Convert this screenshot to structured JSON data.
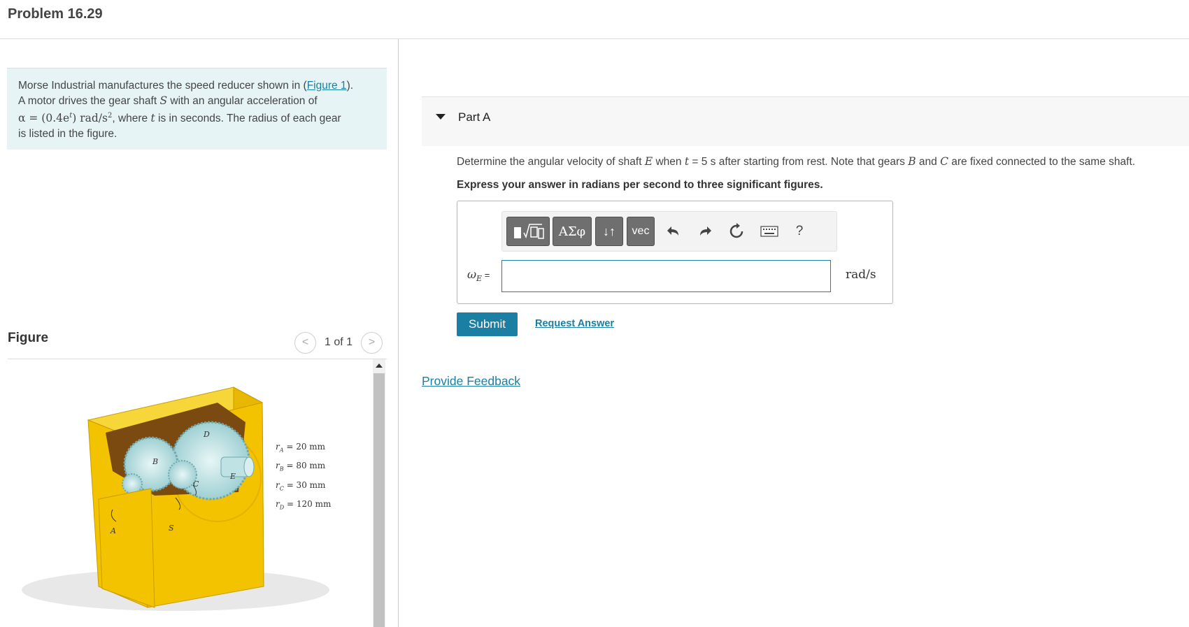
{
  "header": {
    "title": "Problem 16.29"
  },
  "problem": {
    "text_1": "Morse Industrial manufactures the speed reducer shown in (",
    "figure_link": "Figure 1",
    "text_2": ").",
    "text_3": "A motor drives the gear shaft ",
    "var_S": "S",
    "text_4": " with an angular acceleration of",
    "alpha_expr": "α = (0.4e",
    "alpha_exp": "t",
    "alpha_units": ") rad/s",
    "alpha_units_exp": "2",
    "text_5": ", where ",
    "var_t": "t",
    "text_6": " is in seconds. The radius of each gear",
    "text_7": "is listed in the figure."
  },
  "figure": {
    "label": "Figure",
    "prev_icon": "<",
    "next_icon": ">",
    "page_count": "1 of 1",
    "gear_labels": {
      "A": "A",
      "B": "B",
      "C": "C",
      "D": "D",
      "E": "E",
      "S": "S"
    },
    "radii": [
      {
        "sym": "r",
        "sub": "A",
        "value": " = 20 mm"
      },
      {
        "sym": "r",
        "sub": "B",
        "value": " = 80 mm"
      },
      {
        "sym": "r",
        "sub": "C",
        "value": " = 30 mm"
      },
      {
        "sym": "r",
        "sub": "D",
        "value": " = 120 mm"
      }
    ]
  },
  "part": {
    "title": "Part A",
    "q_1": "Determine the angular velocity of shaft ",
    "q_E": "E",
    "q_2": " when ",
    "q_t": "t",
    "q_3": " = 5 s after starting from rest. Note that gears ",
    "q_B": "B",
    "q_4": " and ",
    "q_C": "C",
    "q_5": " are fixed connected to the same shaft.",
    "instruction": "Express your answer in radians per second to three significant figures."
  },
  "toolbar": {
    "templates_icon": "templates-icon",
    "greek_label": "ΑΣφ",
    "arrows_label": "↓↑",
    "vec_label": "vec",
    "undo_icon": "undo-icon",
    "redo_icon": "redo-icon",
    "reset_icon": "reset-icon",
    "keyboard_icon": "keyboard-icon",
    "help_label": "?"
  },
  "answer": {
    "omega_sym": "ω",
    "omega_sub": "E",
    "equals": " =",
    "value": "",
    "units": "rad/s"
  },
  "actions": {
    "submit": "Submit",
    "request_answer": "Request Answer",
    "provide_feedback": "Provide Feedback"
  },
  "colors": {
    "accent": "#1a7fa3",
    "problem_bg": "#e7f4f6",
    "gearbox": "#f4c300"
  }
}
